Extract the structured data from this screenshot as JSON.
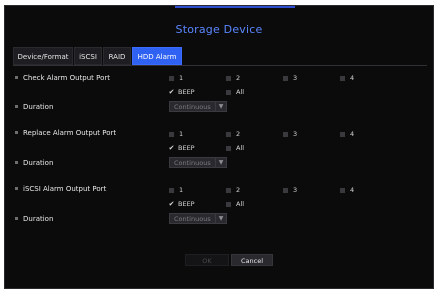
{
  "dialog": {
    "title": "Storage Device"
  },
  "tabs": [
    {
      "label": "Device/Format",
      "active": false
    },
    {
      "label": "iSCSI",
      "active": false
    },
    {
      "label": "RAID",
      "active": false
    },
    {
      "label": "HDD Alarm",
      "active": true
    }
  ],
  "sections": [
    {
      "port_label": "Check Alarm Output Port",
      "ports": [
        "1",
        "2",
        "3",
        "4"
      ],
      "beep_label": "BEEP",
      "beep_checked": true,
      "all_label": "All",
      "all_checked": false,
      "duration_label": "Duration",
      "duration_value": "Continuous"
    },
    {
      "port_label": "Replace Alarm Output Port",
      "ports": [
        "1",
        "2",
        "3",
        "4"
      ],
      "beep_label": "BEEP",
      "beep_checked": true,
      "all_label": "All",
      "all_checked": false,
      "duration_label": "Duration",
      "duration_value": "Continuous"
    },
    {
      "port_label": "iSCSI Alarm Output Port",
      "ports": [
        "1",
        "2",
        "3",
        "4"
      ],
      "beep_label": "BEEP",
      "beep_checked": true,
      "all_label": "All",
      "all_checked": false,
      "duration_label": "Duration",
      "duration_value": "Continuous"
    }
  ],
  "footer": {
    "ok_label": "OK",
    "cancel_label": "Cancel"
  },
  "colors": {
    "accent": "#2f62f2",
    "title": "#5a86ff",
    "background": "#0b0b0c"
  }
}
